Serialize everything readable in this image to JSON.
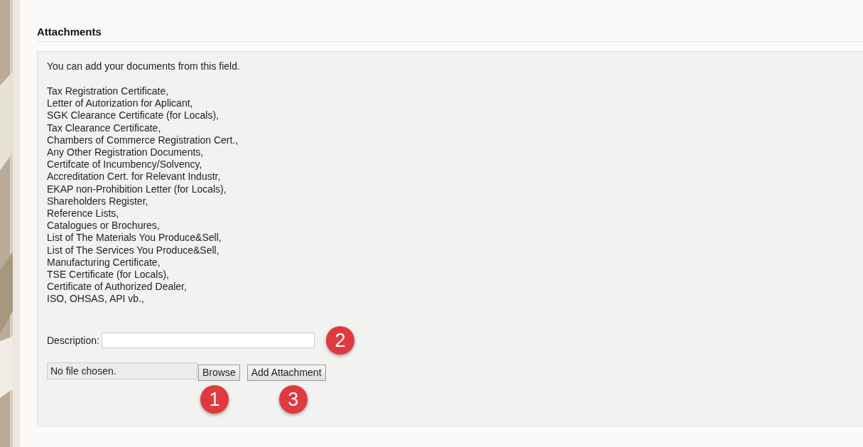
{
  "section": {
    "title": "Attachments"
  },
  "intro": "You can add your documents from this field.",
  "documents": [
    "Tax Registration Certificate,",
    "Letter of Autorization for Aplicant,",
    "SGK Clearance Certificate (for Locals),",
    "Tax Clearance Certificate,",
    "Chambers of Commerce Registration Cert.,",
    "Any Other Registration Documents,",
    "Certifcate of Incumbency/Solvency,",
    "Accreditation Cert. for Relevant Industr,",
    "EKAP non-Prohibition Letter (for Locals),",
    "Shareholders Register,",
    "Reference Lists,",
    "Catalogues or Brochures,",
    "List of The Materials You Produce&Sell,",
    "List of The Services You Produce&Sell,",
    "Manufacturing Certificate,",
    "TSE Certificate (for Locals),",
    "Certificate of Authorized Dealer,",
    "ISO, OHSAS, API vb.,"
  ],
  "description": {
    "label": "Description:",
    "callout": "2"
  },
  "file_input": {
    "status": "No file chosen.",
    "button": "Browse",
    "callout": "1"
  },
  "add_button": {
    "label": "Add Attachment",
    "callout": "3"
  }
}
